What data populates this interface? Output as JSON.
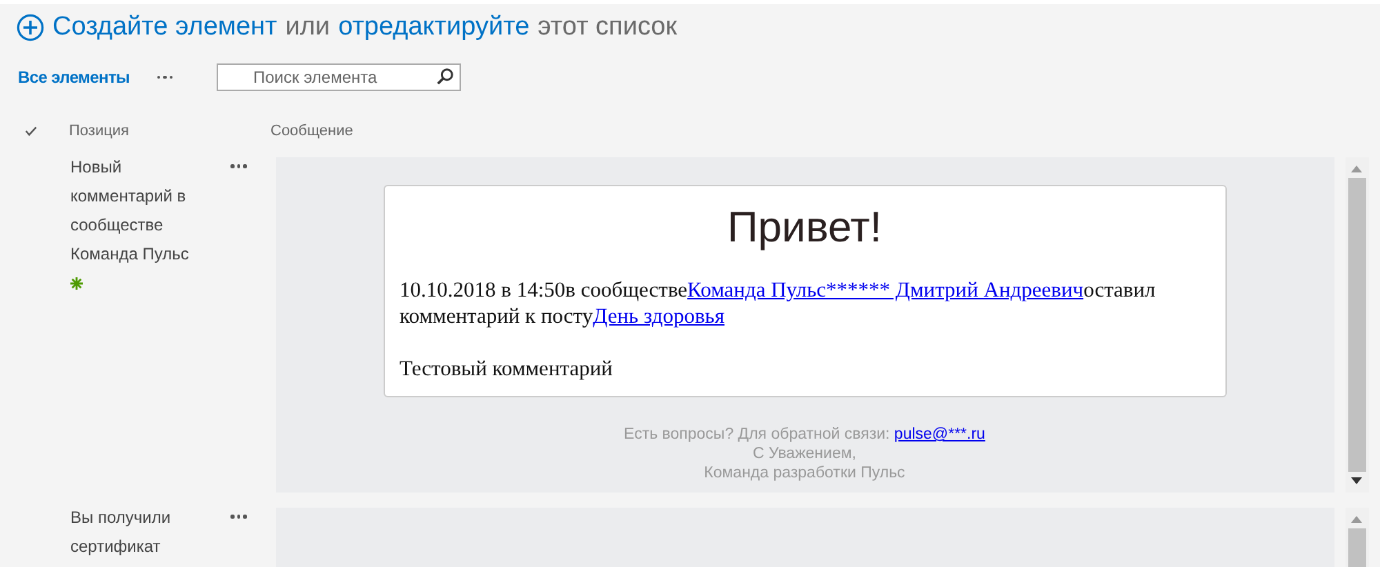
{
  "header": {
    "create_link": "Создайте элемент",
    "connector": "или",
    "edit_link": "отредактируйте",
    "suffix": "этот список"
  },
  "views": [
    {
      "label": "Все элементы",
      "selected": true
    }
  ],
  "search": {
    "placeholder": "Поиск элемента"
  },
  "columns": [
    "Позиция",
    "Сообщение"
  ],
  "rows": [
    {
      "title": "Новый комментарий в сообществе Команда Пульс",
      "new": true,
      "message": {
        "heading": "Привет!",
        "body": [
          {
            "kind": "text",
            "text": "10.10.2018 в 14:50в сообществе"
          },
          {
            "kind": "link",
            "text": "Команда Пульс****** Дмитрий Андреевич"
          },
          {
            "kind": "text",
            "text": "оставил комментарий к посту"
          },
          {
            "kind": "link",
            "text": "День здоровья"
          }
        ],
        "comment": "Тестовый комментарий",
        "footer": {
          "question": "Есть вопросы? Для обратной связи:",
          "email": "pulse@***.ru",
          "regards": "С Уважением,",
          "team": "Команда разработки Пульс"
        }
      }
    },
    {
      "title": "Вы получили сертификат",
      "new": false
    }
  ]
}
